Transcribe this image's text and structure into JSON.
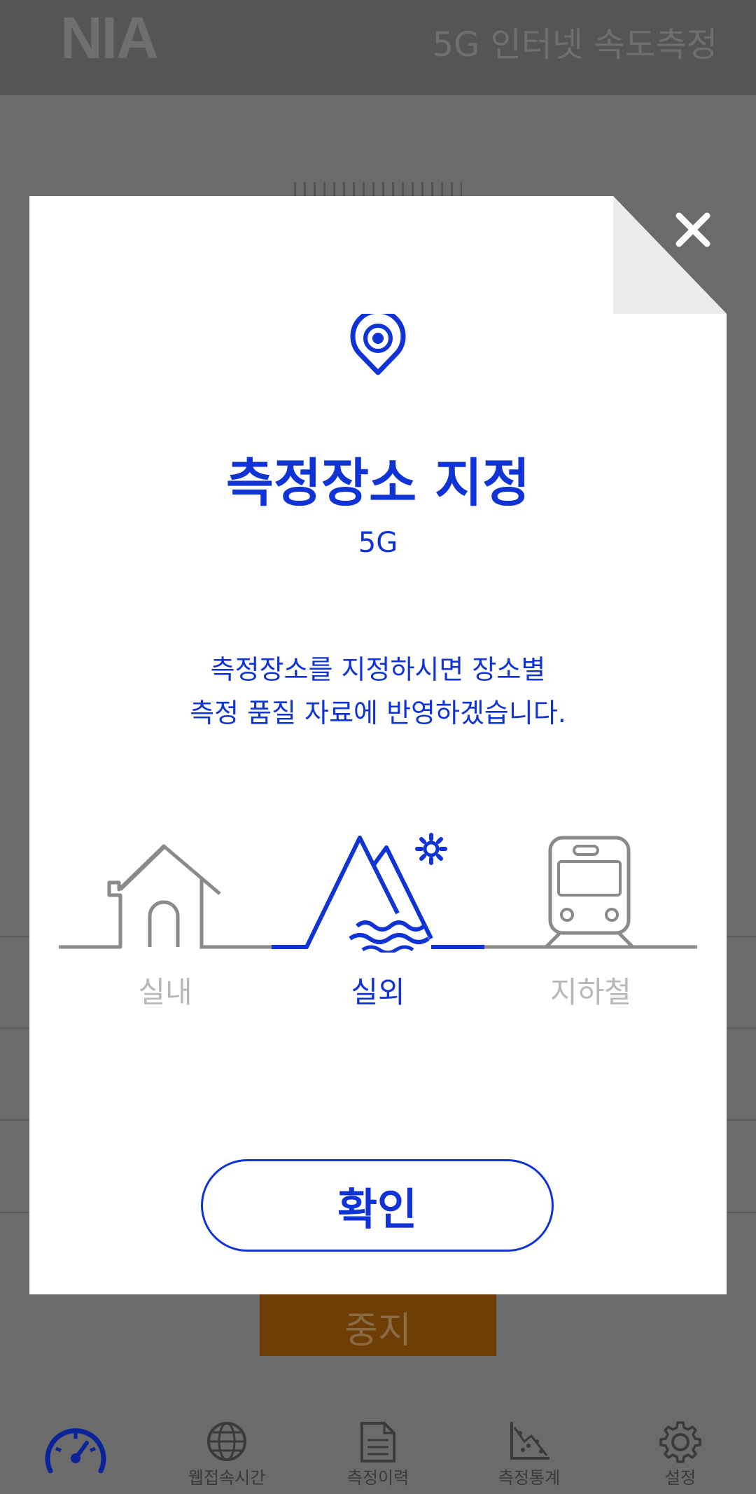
{
  "app": {
    "logo": "NIA",
    "header_title": "5G 인터넷 속도측정",
    "stop_label": "중지"
  },
  "tabs": [
    {
      "label": "",
      "icon": "speedometer-icon",
      "active": true
    },
    {
      "label": "웹접속시간",
      "icon": "globe-icon"
    },
    {
      "label": "측정이력",
      "icon": "document-icon"
    },
    {
      "label": "측정통계",
      "icon": "scatter-chart-icon"
    },
    {
      "label": "설정",
      "icon": "gear-icon"
    }
  ],
  "modal": {
    "title": "측정장소 지정",
    "subtitle": "5G",
    "description_line1": "측정장소를 지정하시면 장소별",
    "description_line2": "측정 품질 자료에 반영하겠습니다.",
    "options": [
      {
        "label": "실내",
        "icon": "house-icon",
        "selected": false
      },
      {
        "label": "실외",
        "icon": "mountain-icon",
        "selected": true
      },
      {
        "label": "지하철",
        "icon": "subway-icon",
        "selected": false
      }
    ],
    "confirm_label": "확인"
  },
  "colors": {
    "accent": "#1033d6",
    "inactive": "#b8b8b8",
    "overlay_gray": "#6b6b6b",
    "stop_button": "#6e3e06"
  }
}
